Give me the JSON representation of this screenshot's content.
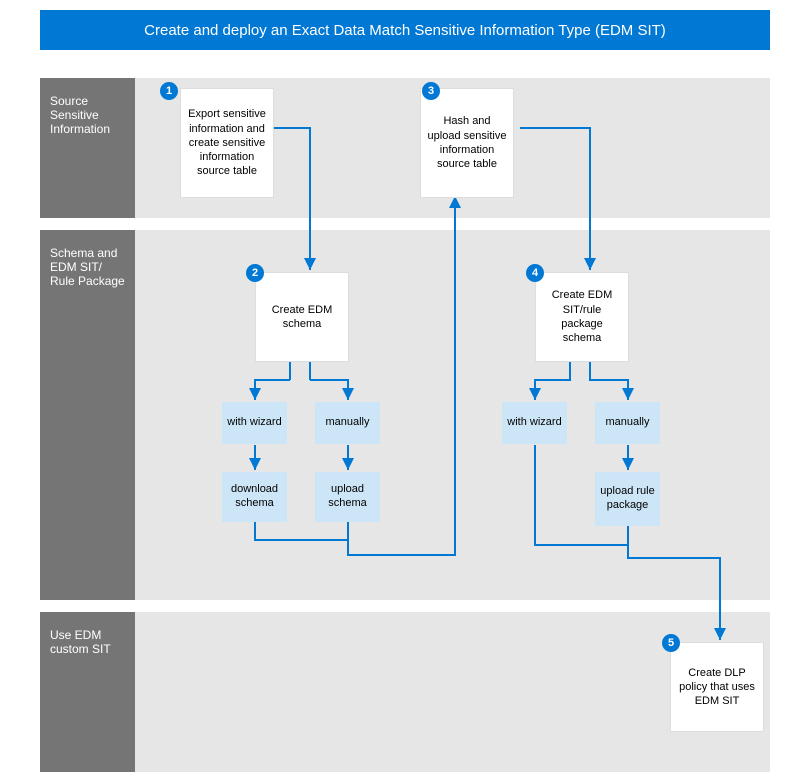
{
  "title": "Create and deploy an Exact Data Match Sensitive Information Type (EDM SIT)",
  "rows": {
    "r1": "Source Sensitive Information",
    "r2": "Schema and EDM SIT/\nRule Package",
    "r3": "Use EDM custom SIT"
  },
  "badges": {
    "b1": "1",
    "b2": "2",
    "b3": "3",
    "b4": "4",
    "b5": "5"
  },
  "nodes": {
    "n1": "Export sensitive information and create sensitive information source table",
    "n2": "Create EDM schema",
    "n3": "Hash and upload sensitive information source table",
    "n4": "Create EDM SIT/rule package schema",
    "n5": "Create DLP policy that uses EDM SIT"
  },
  "blue": {
    "wiz": "with wizard",
    "man": "manually",
    "dl": "download schema",
    "ul": "upload schema",
    "ulrule": "upload rule package"
  },
  "colors": {
    "brand": "#0078D4",
    "light": "#CDE6F7",
    "grey": "#E6E6E7",
    "dark": "#757575"
  }
}
